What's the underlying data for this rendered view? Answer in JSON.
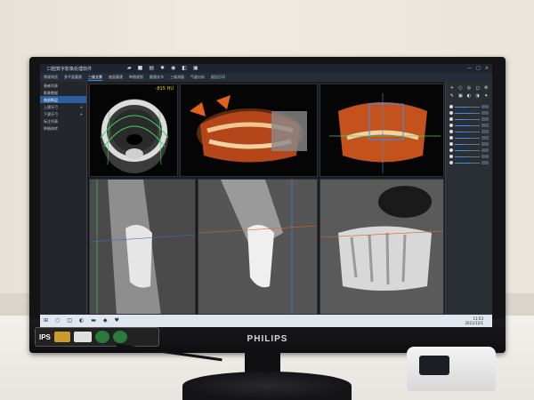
{
  "app": {
    "title": "口腔数字影像处理软件",
    "toolbar_icons": [
      "folder-icon",
      "save-icon",
      "print-icon",
      "settings-icon",
      "camera-icon",
      "export-icon",
      "share-icon"
    ],
    "window_controls": [
      "—",
      "□",
      "×"
    ]
  },
  "tabs": [
    {
      "label": "常规浏览",
      "active": false
    },
    {
      "label": "多平面重建",
      "active": false
    },
    {
      "label": "三维全景",
      "active": true
    },
    {
      "label": "曲面重建",
      "active": false
    },
    {
      "label": "种植规划",
      "active": false
    },
    {
      "label": "颞颌关节",
      "active": false
    },
    {
      "label": "三维测量",
      "active": false
    },
    {
      "label": "气道分析",
      "active": false
    },
    {
      "label": "报告打印",
      "active": false
    }
  ],
  "sidebar": {
    "items": [
      {
        "label": "患者列表",
        "selected": false,
        "badge": ""
      },
      {
        "label": "影像数据",
        "selected": false,
        "badge": ""
      },
      {
        "label": "曲面断层",
        "selected": true,
        "badge": ""
      },
      {
        "label": "上颌牙弓",
        "selected": false,
        "badge": "+"
      },
      {
        "label": "下颌牙弓",
        "selected": false,
        "badge": "+"
      },
      {
        "label": "标注列表",
        "selected": false,
        "badge": ""
      },
      {
        "label": "种植体库",
        "selected": false,
        "badge": ""
      }
    ]
  },
  "viewports": {
    "axial": {
      "hu_readout": "-815 HU"
    }
  },
  "rightpanel": {
    "tool_icons": [
      "+",
      "○",
      "◎",
      "◻",
      "⚙",
      "✎",
      "▣",
      "◐",
      "◑",
      "✦"
    ],
    "sliders": [
      0.55,
      0.7,
      0.45,
      0.6,
      0.5,
      0.65,
      0.4,
      0.55,
      0.5,
      0.6
    ]
  },
  "taskbar": {
    "icons": [
      "windows-icon",
      "search-icon",
      "taskview-icon",
      "edge-icon",
      "folder-icon",
      "app-icon",
      "tooth-icon"
    ],
    "time": "11:53",
    "date": "2021/12/1"
  },
  "monitor": {
    "brand": "PHILIPS",
    "sticker_text": "IPS"
  },
  "colors": {
    "accent": "#2d8cf0",
    "hu_text": "#ffcc00",
    "render_orange": "#e2621b"
  }
}
